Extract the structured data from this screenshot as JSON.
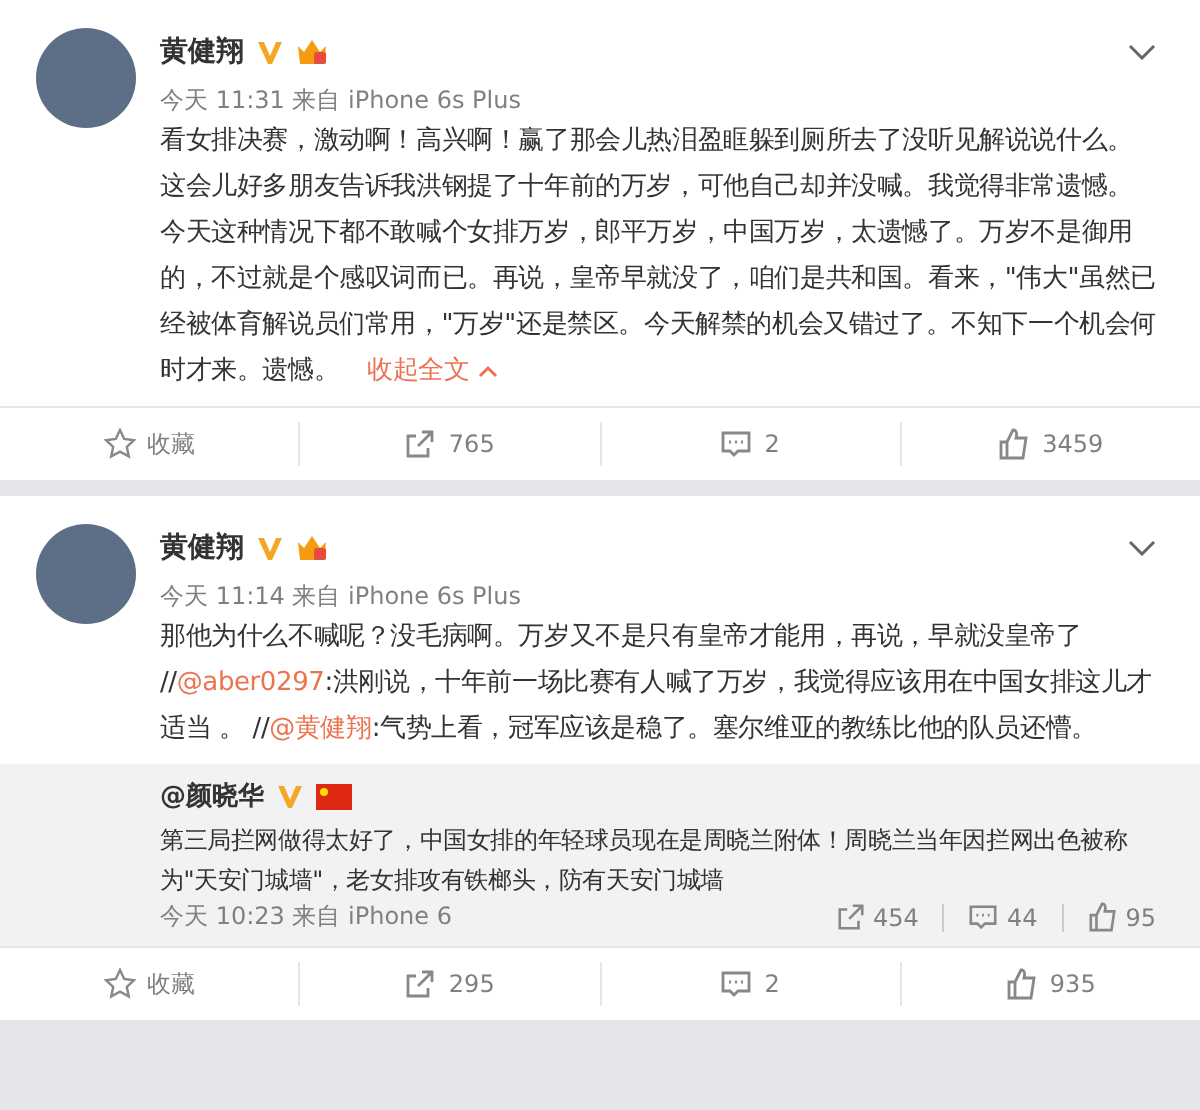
{
  "posts": [
    {
      "author": "黄健翔",
      "time": "今天 11:31 来自 iPhone 6s Plus",
      "body": [
        {
          "kind": "text",
          "text": "看女排决赛，激动啊！高兴啊！赢了那会儿热泪盈眶躲到厕所去了没听见解说说什么。这会儿好多朋友告诉我洪钢提了十年前的万岁，可他自己却并没喊。我觉得非常遗憾。今天这种情况下都不敢喊个女排万岁，郎平万岁，中国万岁，太遗憾了。万岁不是御用的，不过就是个感叹词而已。再说，皇帝早就没了，咱们是共和国。看来，\"伟大\"虽然已经被体育解说员们常用，\"万岁\"还是禁区。今天解禁的机会又错过了。不知下一个机会何时才来。遗憾。 "
        },
        {
          "kind": "collapse",
          "text": "收起全文"
        }
      ],
      "actions": [
        {
          "kind": "favorite",
          "label": "收藏"
        },
        {
          "kind": "repost",
          "label": "765"
        },
        {
          "kind": "comment",
          "label": "2"
        },
        {
          "kind": "like",
          "label": "3459"
        }
      ]
    },
    {
      "author": "黄健翔",
      "time": "今天 11:14 来自 iPhone 6s Plus",
      "body": [
        {
          "kind": "text",
          "text": "那他为什么不喊呢？没毛病啊。万岁又不是只有皇帝才能用，再说，早就没皇帝了 //"
        },
        {
          "kind": "mention",
          "text": "@aber0297"
        },
        {
          "kind": "text",
          "text": ":洪刚说，十年前一场比赛有人喊了万岁，我觉得应该用在中国女排这儿才适当 。 //"
        },
        {
          "kind": "mention",
          "text": "@黄健翔"
        },
        {
          "kind": "text",
          "text": ":气势上看，冠军应该是稳了。塞尔维亚的教练比他的队员还懵。"
        }
      ],
      "repost": {
        "author": "@颜晓华",
        "text": "第三局拦网做得太好了，中国女排的年轻球员现在是周晓兰附体！周晓兰当年因拦网出色被称为\"天安门城墙\"，老女排攻有铁榔头，防有天安门城墙",
        "time": "今天 10:23 来自 iPhone 6",
        "stats": [
          {
            "kind": "repost",
            "label": "454"
          },
          {
            "kind": "comment",
            "label": "44"
          },
          {
            "kind": "like",
            "label": "95"
          }
        ]
      },
      "actions": [
        {
          "kind": "favorite",
          "label": "收藏"
        },
        {
          "kind": "repost",
          "label": "295"
        },
        {
          "kind": "comment",
          "label": "2"
        },
        {
          "kind": "like",
          "label": "935"
        }
      ]
    }
  ]
}
